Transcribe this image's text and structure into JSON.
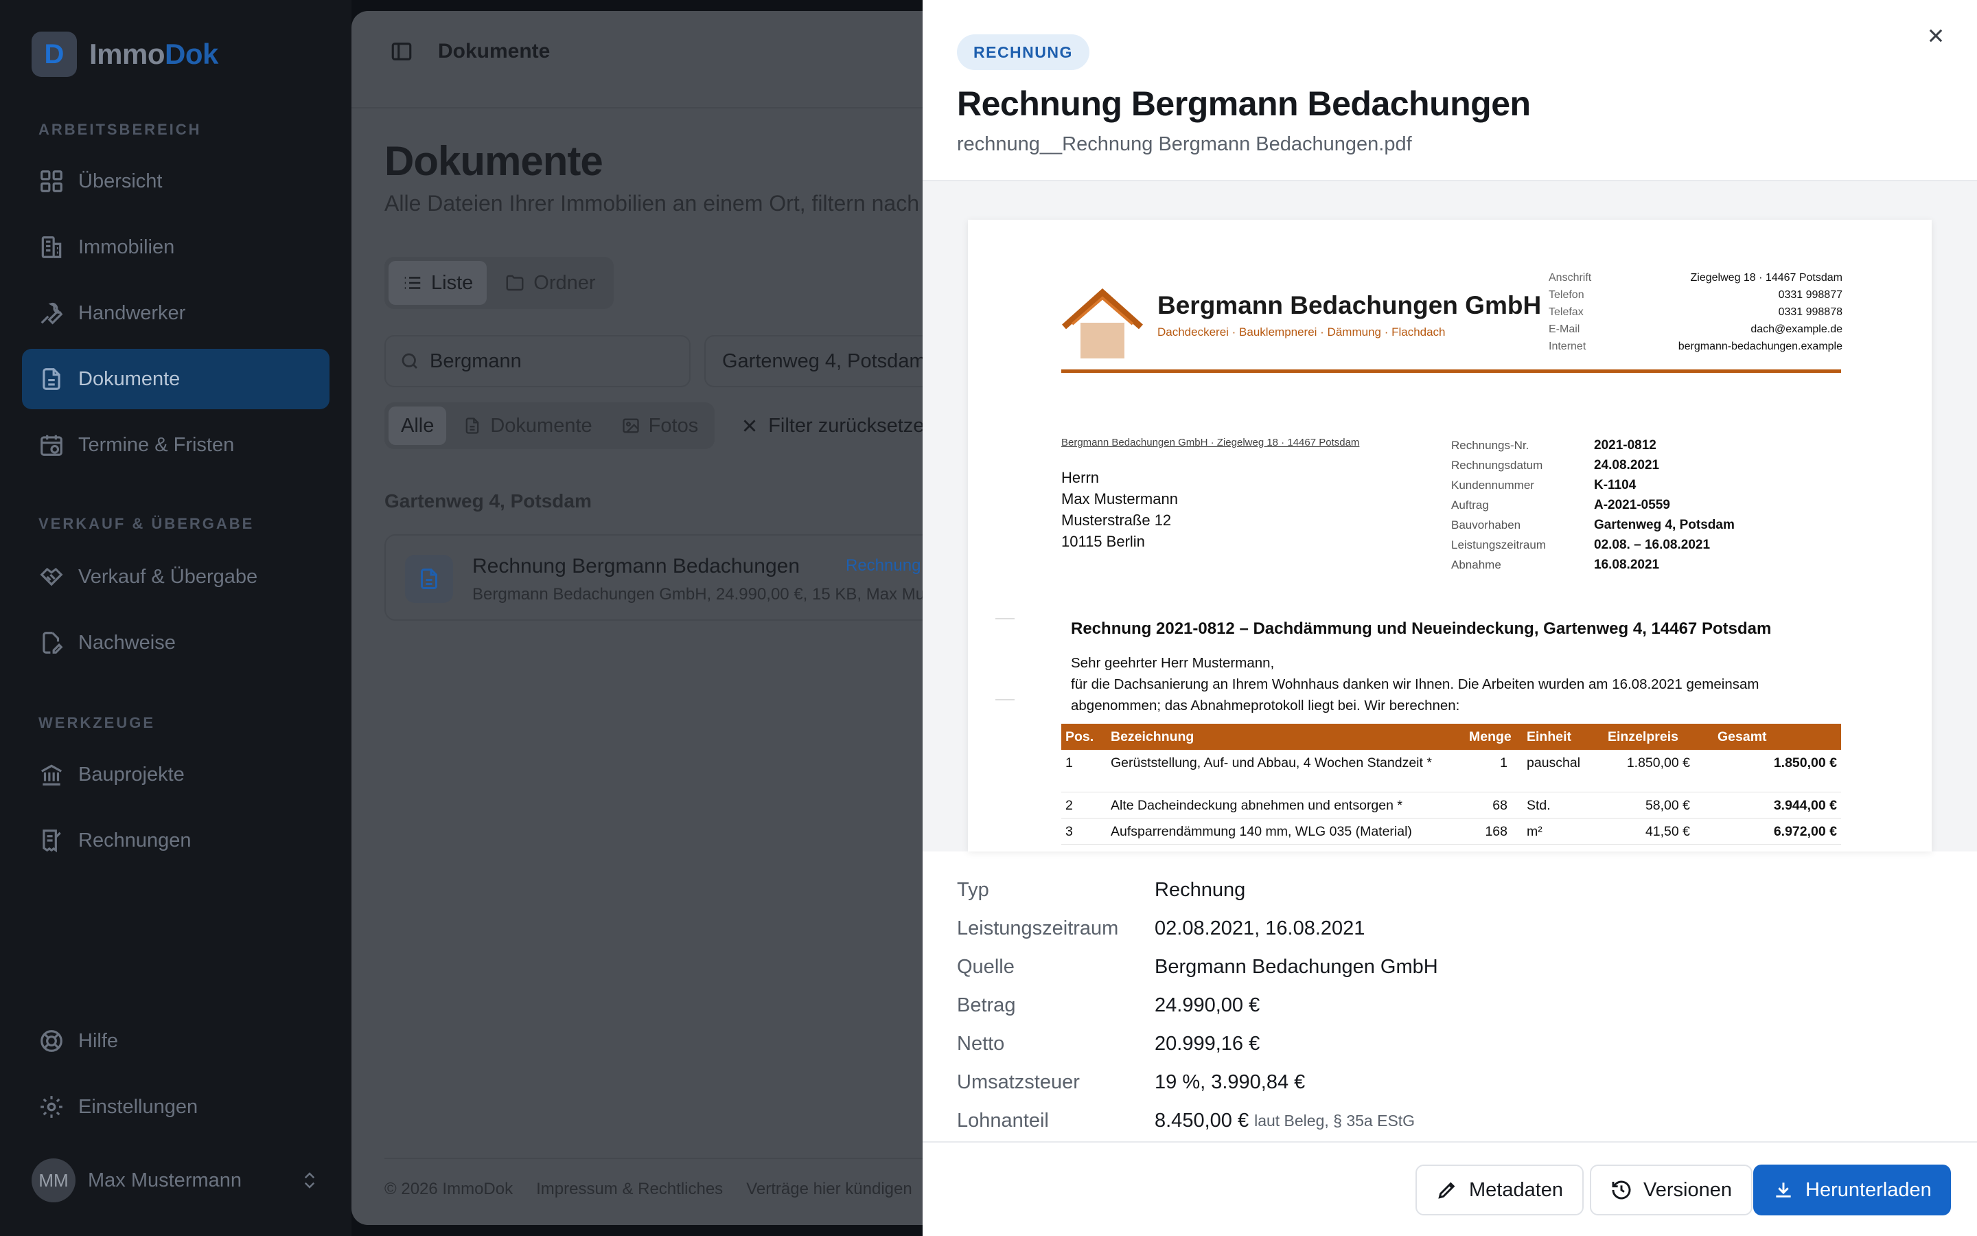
{
  "sidebar": {
    "logo_a": "Immo",
    "logo_b": "Dok",
    "sections": {
      "arbeitsbereich": "ARBEITSBEREICH",
      "verkauf": "VERKAUF & ÜBERGABE",
      "werkzeuge": "WERKZEUGE"
    },
    "items": {
      "uebersicht": "Übersicht",
      "immobilien": "Immobilien",
      "handwerker": "Handwerker",
      "dokumente": "Dokumente",
      "termine": "Termine & Fristen",
      "verkauf": "Verkauf & Übergabe",
      "nachweise": "Nachweise",
      "bauprojekte": "Bauprojekte",
      "rechnungen": "Rechnungen",
      "hilfe": "Hilfe",
      "einstellungen": "Einstellungen"
    },
    "user": {
      "initials": "MM",
      "name": "Max Mustermann"
    }
  },
  "main": {
    "topbar_title": "Dokumente",
    "title": "Dokumente",
    "subtitle": "Alle Dateien Ihrer Immobilien an einem Ort, filtern nach",
    "view_tabs": {
      "liste": "Liste",
      "ordner": "Ordner"
    },
    "search_value": "Bergmann",
    "property_select": "Gartenweg 4, Potsdam",
    "filters": {
      "alle": "Alle",
      "dokumente": "Dokumente",
      "fotos": "Fotos",
      "reset": "Filter zurücksetzen"
    },
    "group_title": "Gartenweg 4, Potsdam",
    "document": {
      "title": "Rechnung Bergmann Bedachungen",
      "badge": "Rechnung",
      "meta": "Bergmann Bedachungen GmbH, 24.990,00 €, 15 KB, Max Mu"
    },
    "footer": {
      "copyright": "© 2026 ImmoDok",
      "impressum": "Impressum & Rechtliches",
      "kuendigen": "Verträge hier kündigen"
    }
  },
  "drawer": {
    "type_pill": "RECHNUNG",
    "title": "Rechnung Bergmann Bedachungen",
    "filename": "rechnung__Rechnung Bergmann Bedachungen.pdf",
    "pdf": {
      "company": "Bergmann Bedachungen GmbH",
      "tagline": "Dachdeckerei · Bauklempnerei · Dämmung · Flachdach",
      "contact": [
        {
          "k": "Anschrift",
          "v": "Ziegelweg 18 · 14467 Potsdam"
        },
        {
          "k": "Telefon",
          "v": "0331 998877"
        },
        {
          "k": "Telefax",
          "v": "0331 998878"
        },
        {
          "k": "E-Mail",
          "v": "dach@example.de"
        },
        {
          "k": "Internet",
          "v": "bergmann-bedachungen.example"
        }
      ],
      "sender_line": "Bergmann Bedachungen GmbH · Ziegelweg 18 · 14467 Potsdam",
      "address": [
        "Herrn",
        "Max Mustermann",
        "Musterstraße 12",
        "10115 Berlin"
      ],
      "info": [
        {
          "k": "Rechnungs-Nr.",
          "v": "2021-0812"
        },
        {
          "k": "Rechnungsdatum",
          "v": "24.08.2021"
        },
        {
          "k": "Kundennummer",
          "v": "K-1104"
        },
        {
          "k": "Auftrag",
          "v": "A-2021-0559"
        },
        {
          "k": "Bauvorhaben",
          "v": "Gartenweg 4, Potsdam"
        },
        {
          "k": "Leistungszeitraum",
          "v": "02.08. – 16.08.2021"
        },
        {
          "k": "Abnahme",
          "v": "16.08.2021"
        }
      ],
      "subject": "Rechnung 2021-0812 – Dachdämmung und Neueindeckung, Gartenweg 4, 14467 Potsdam",
      "salutation": "Sehr geehrter Herr Mustermann,",
      "intro": "für die Dachsanierung an Ihrem Wohnhaus danken wir Ihnen. Die Arbeiten wurden am 16.08.2021 gemeinsam abgenommen; das Abnahmeprotokoll liegt bei. Wir berechnen:",
      "table_head": {
        "pos": "Pos.",
        "bez": "Bezeichnung",
        "menge": "Menge",
        "einheit": "Einheit",
        "ep": "Einzelpreis",
        "ges": "Gesamt"
      },
      "rows": [
        {
          "pos": "1",
          "bez": "Gerüststellung, Auf- und Abbau, 4 Wochen Standzeit *",
          "menge": "1",
          "einheit": "pauschal",
          "ep": "1.850,00 €",
          "ges": "1.850,00 €"
        },
        {
          "pos": "2",
          "bez": "Alte Dacheindeckung abnehmen und entsorgen *",
          "menge": "68",
          "einheit": "Std.",
          "ep": "58,00 €",
          "ges": "3.944,00 €"
        },
        {
          "pos": "3",
          "bez": "Aufsparrendämmung 140 mm, WLG 035 (Material)",
          "menge": "168",
          "einheit": "m²",
          "ep": "41,50 €",
          "ges": "6.972,00 €"
        }
      ]
    },
    "meta": {
      "typ": {
        "k": "Typ",
        "v": "Rechnung"
      },
      "zeitraum": {
        "k": "Leistungszeitraum",
        "v": "02.08.2021, 16.08.2021"
      },
      "quelle": {
        "k": "Quelle",
        "v": "Bergmann Bedachungen GmbH"
      },
      "betrag": {
        "k": "Betrag",
        "v": "24.990,00 €"
      },
      "netto": {
        "k": "Netto",
        "v": "20.999,16 €"
      },
      "ust": {
        "k": "Umsatzsteuer",
        "v": "19 %, 3.990,84 €"
      },
      "lohn": {
        "k": "Lohnanteil",
        "v": "8.450,00 €",
        "note": "laut Beleg, § 35a EStG"
      }
    },
    "buttons": {
      "metadaten": "Metadaten",
      "versionen": "Versionen",
      "download": "Herunterladen"
    }
  }
}
